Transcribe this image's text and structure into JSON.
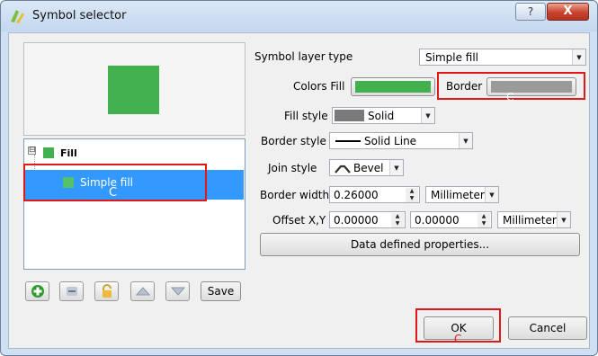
{
  "window": {
    "title": "Symbol selector",
    "help_glyph": "?",
    "close_glyph": "X"
  },
  "tree": {
    "root_label": "Fill",
    "expander_glyph": "⊟",
    "child_label": "Simple fill",
    "cursor_label": "C"
  },
  "toolbar": {
    "save_label": "Save"
  },
  "form": {
    "layer_type_label": "Symbol layer type",
    "layer_type_value": "Simple fill",
    "colors_fill_label": "Colors Fill",
    "border_label": "Border",
    "border_cursor": "C",
    "fill_style_label": "Fill style",
    "fill_style_value": "Solid",
    "border_style_label": "Border style",
    "border_style_value": "Solid Line",
    "join_style_label": "Join style",
    "join_style_value": "Bevel",
    "border_width_label": "Border width",
    "border_width_value": "0.26000",
    "border_width_unit": "Millimeter",
    "offset_label": "Offset X,Y",
    "offset_x": "0.00000",
    "offset_y": "0.00000",
    "offset_unit": "Millimeter",
    "data_defined_label": "Data defined properties..."
  },
  "buttons": {
    "ok_label": "OK",
    "ok_cursor": "C",
    "cancel_label": "Cancel"
  },
  "colors": {
    "fill": "#43b04f",
    "border": "#9a9a9a",
    "highlight": "#e01818",
    "selection": "#3399ff"
  },
  "icons": [
    "symbol-app-icon",
    "add-layer-icon",
    "remove-layer-icon",
    "lock-icon",
    "move-up-icon",
    "move-down-icon",
    "bevel-join-icon"
  ]
}
